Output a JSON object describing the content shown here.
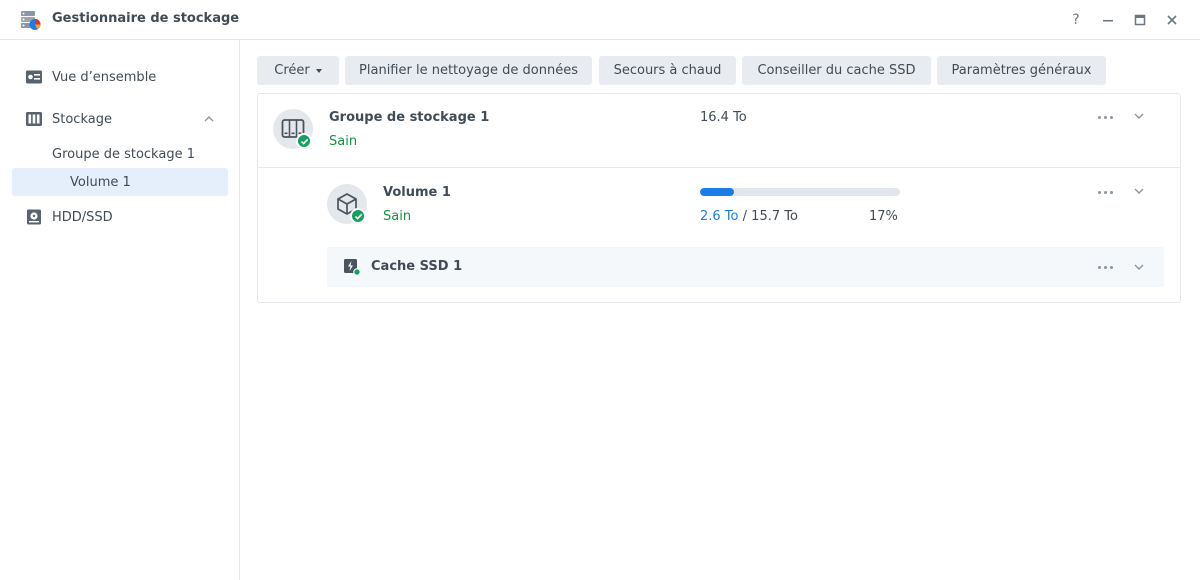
{
  "window": {
    "title": "Gestionnaire de stockage",
    "controls": {
      "help": "?",
      "minimize": "—",
      "maximize": "□",
      "close": "✕"
    }
  },
  "sidebar": {
    "items": [
      {
        "label": "Vue d’ensemble",
        "icon": "overview-icon"
      },
      {
        "label": "Stockage",
        "icon": "storage-icon",
        "expanded": true
      },
      {
        "label": "Groupe de stockage 1"
      },
      {
        "label": "Volume 1",
        "selected": true
      },
      {
        "label": "HDD/SSD",
        "icon": "disk-icon"
      }
    ]
  },
  "toolbar": {
    "create_label": "Créer",
    "schedule_label": "Planifier le nettoyage de données",
    "hotspare_label": "Secours à chaud",
    "ssd_advisor_label": "Conseiller du cache SSD",
    "settings_label": "Paramètres généraux"
  },
  "pool": {
    "name": "Groupe de stockage 1",
    "status": "Sain",
    "capacity": "16.4 To"
  },
  "volume": {
    "name": "Volume 1",
    "status": "Sain",
    "used": "2.6 To",
    "separator": "/",
    "total": "15.7 To",
    "percent_label": "17%",
    "usage_fraction": 0.17
  },
  "cache": {
    "name": "Cache SSD 1"
  },
  "colors": {
    "accent": "#1a7de6",
    "healthy": "#16a05d",
    "selected_bg": "#e4effb"
  }
}
